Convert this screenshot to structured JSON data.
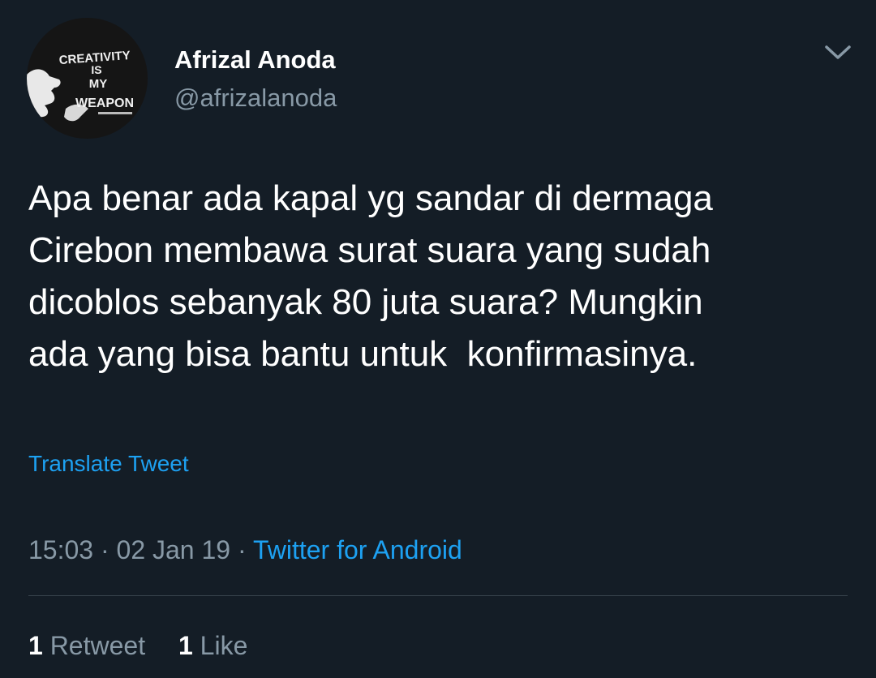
{
  "tweet": {
    "author": {
      "name": "Afrizal Anoda",
      "handle": "@afrizalanoda",
      "avatar_text": [
        "CREATIVITY",
        "IS",
        "MY",
        "WEAPON"
      ]
    },
    "menu_icon": "chevron-down-icon",
    "text": "Apa benar ada kapal yg sandar di dermaga\nCirebon membawa surat suara yang sudah\ndicoblos sebanyak 80 juta suara? Mungkin\nada yang bisa bantu untuk  konfirmasinya.",
    "translate_label": "Translate Tweet",
    "time": "15:03",
    "separator": " · ",
    "date": "02 Jan 19",
    "source": "Twitter for Android",
    "retweets": {
      "count": "1",
      "label": "Retweet"
    },
    "likes": {
      "count": "1",
      "label": "Like"
    }
  },
  "colors": {
    "background": "#141d26",
    "text_primary": "#ffffff",
    "text_secondary": "#8899a6",
    "link": "#1da1f2",
    "divider": "#38444d"
  }
}
